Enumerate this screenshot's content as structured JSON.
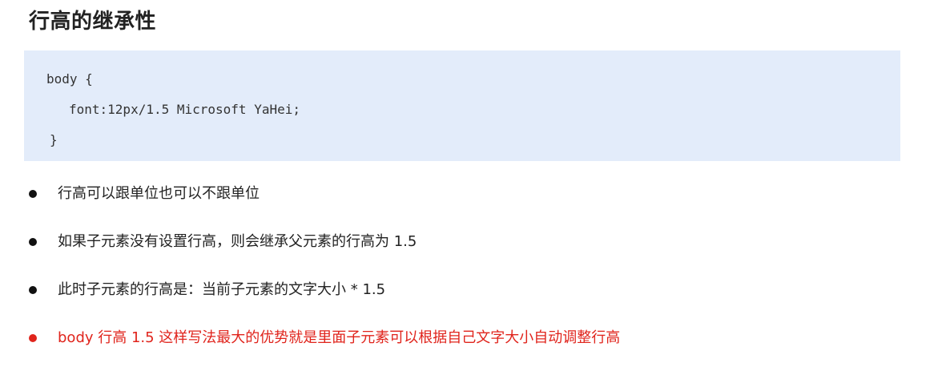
{
  "heading": "行高的继承性",
  "code": {
    "line1": "body {",
    "line2": "font:12px/1.5 Microsoft YaHei;",
    "line3": "}"
  },
  "bullets": [
    {
      "text": "行高可以跟单位也可以不跟单位",
      "color": "#222222"
    },
    {
      "text": "如果子元素没有设置行高，则会继承父元素的行高为 1.5",
      "color": "#222222"
    },
    {
      "text": "此时子元素的行高是：当前子元素的文字大小 * 1.5",
      "color": "#222222"
    },
    {
      "text": "body 行高 1.5  这样写法最大的优势就是里面子元素可以根据自己文字大小自动调整行高",
      "color": "#e0241c"
    }
  ],
  "colors": {
    "code_background": "#e3ecfa",
    "highlight": "#e0241c"
  }
}
